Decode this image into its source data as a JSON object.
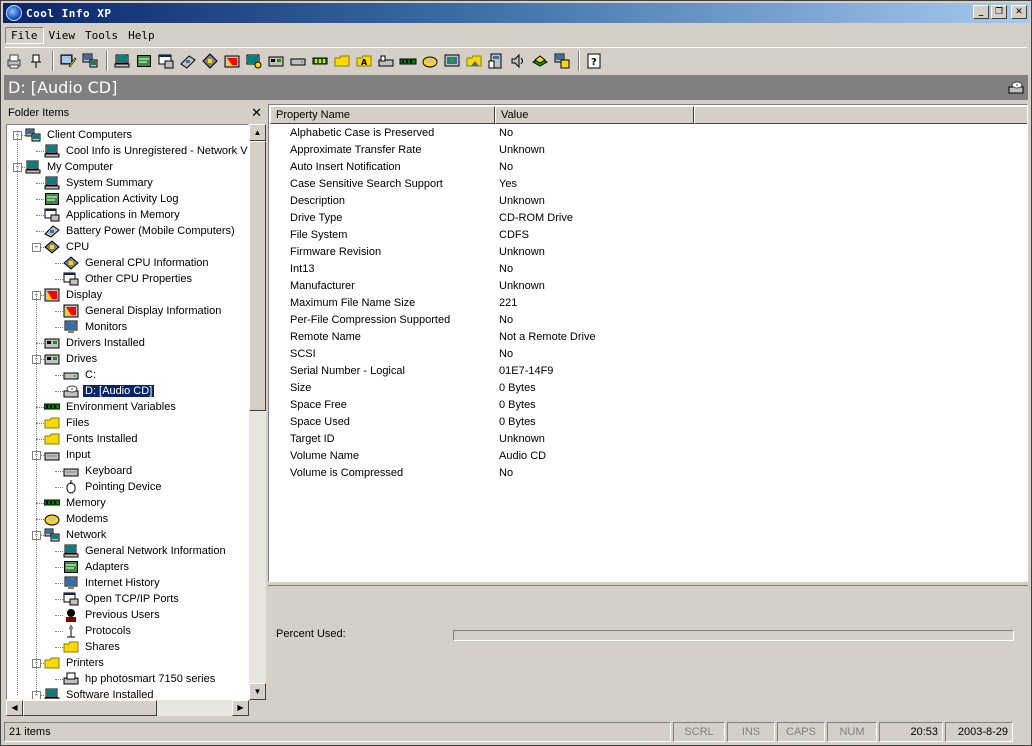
{
  "window": {
    "title": "Cool Info XP",
    "controls": {
      "minimize": "_",
      "restore": "❐",
      "close": "✕"
    }
  },
  "menu": [
    {
      "label": "File",
      "active": true
    },
    {
      "label": "View"
    },
    {
      "label": "Tools"
    },
    {
      "label": "Help"
    }
  ],
  "header": {
    "title": "D: [Audio CD]"
  },
  "folder_pane": {
    "title": "Folder Items",
    "close": "✕",
    "tree": [
      {
        "label": "Client Computers"
      },
      {
        "label": "Cool Info is Unregistered - Network V"
      },
      {
        "label": "My Computer"
      },
      {
        "label": "System Summary"
      },
      {
        "label": "Application Activity Log"
      },
      {
        "label": "Applications in Memory"
      },
      {
        "label": "Battery Power (Mobile Computers)"
      },
      {
        "label": "CPU"
      },
      {
        "label": "General CPU Information"
      },
      {
        "label": "Other CPU Properties"
      },
      {
        "label": "Display"
      },
      {
        "label": "General Display Information"
      },
      {
        "label": "Monitors"
      },
      {
        "label": "Drivers Installed"
      },
      {
        "label": "Drives"
      },
      {
        "label": "C:"
      },
      {
        "label": "D: [Audio CD]"
      },
      {
        "label": "Environment Variables"
      },
      {
        "label": "Files"
      },
      {
        "label": "Fonts Installed"
      },
      {
        "label": "Input"
      },
      {
        "label": "Keyboard"
      },
      {
        "label": "Pointing Device"
      },
      {
        "label": "Memory"
      },
      {
        "label": "Modems"
      },
      {
        "label": "Network"
      },
      {
        "label": "General Network Information"
      },
      {
        "label": "Adapters"
      },
      {
        "label": "Internet History"
      },
      {
        "label": "Open TCP/IP Ports"
      },
      {
        "label": "Previous Users"
      },
      {
        "label": "Protocols"
      },
      {
        "label": "Shares"
      },
      {
        "label": "Printers"
      },
      {
        "label": "hp photosmart 7150 series"
      },
      {
        "label": "Software Installed"
      }
    ]
  },
  "properties": {
    "columns": [
      "Property Name",
      "Value"
    ],
    "rows": [
      [
        "Alphabetic Case is Preserved",
        "No"
      ],
      [
        "Approximate Transfer Rate",
        "Unknown"
      ],
      [
        "Auto Insert Notification",
        "No"
      ],
      [
        "Case Sensitive Search Support",
        "Yes"
      ],
      [
        "Description",
        "Unknown"
      ],
      [
        "Drive Type",
        "CD-ROM Drive"
      ],
      [
        "File System",
        "CDFS"
      ],
      [
        "Firmware Revision",
        "Unknown"
      ],
      [
        "Int13",
        "No"
      ],
      [
        "Manufacturer",
        "Unknown"
      ],
      [
        "Maximum File Name Size",
        "221"
      ],
      [
        "Per-File Compression Supported",
        "No"
      ],
      [
        "Remote Name",
        "Not a Remote Drive"
      ],
      [
        "SCSI",
        "No"
      ],
      [
        "Serial Number - Logical",
        "01E7-14F9"
      ],
      [
        "Size",
        "0 Bytes"
      ],
      [
        "Space Free",
        "0 Bytes"
      ],
      [
        "Space Used",
        "0 Bytes"
      ],
      [
        "Target ID",
        "Unknown"
      ],
      [
        "Volume Name",
        "Audio CD"
      ],
      [
        "Volume is Compressed",
        "No"
      ]
    ]
  },
  "detail": {
    "percent_label": "Percent Used:",
    "percent_used": 0
  },
  "statusbar": {
    "items": "21 items",
    "scrl": "SCRL",
    "ins": "INS",
    "caps": "CAPS",
    "num": "NUM",
    "time": "20:53",
    "date": "2003-8-29"
  },
  "colors": {
    "title_start": "#0a246a",
    "title_end": "#a6caf0",
    "selection": "#0a246a",
    "face": "#d4d0c8",
    "header_band": "#808080"
  }
}
